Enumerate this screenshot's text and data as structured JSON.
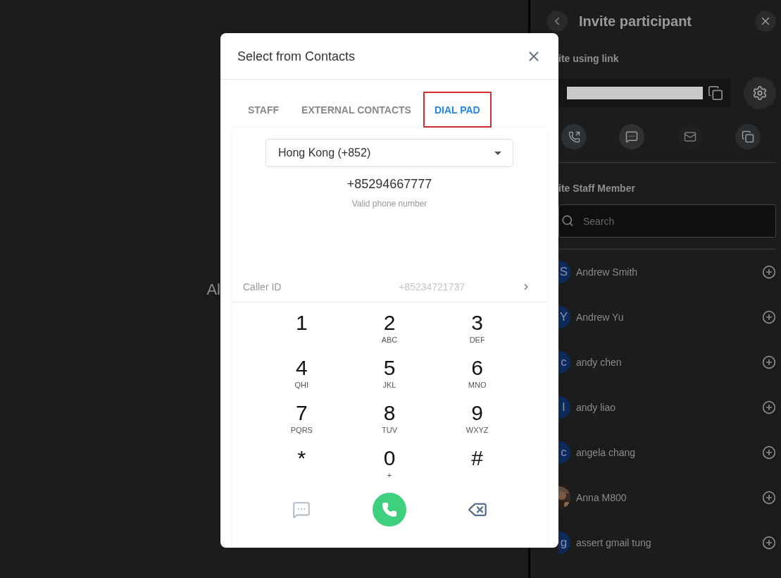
{
  "background": {
    "text": "Al"
  },
  "modal": {
    "title": "Select from Contacts",
    "tabs": [
      {
        "label": "STAFF",
        "selected": false
      },
      {
        "label": "EXTERNAL CONTACTS",
        "selected": false
      },
      {
        "label": "DIAL PAD",
        "selected": true
      }
    ],
    "country": "Hong Kong (+852)",
    "number": "+85294667777",
    "validity": "Valid phone number",
    "caller_id": {
      "label": "Caller ID",
      "value": "+85234721737"
    },
    "keys": [
      {
        "digit": "1"
      },
      {
        "digit": "2",
        "letters": "ABC"
      },
      {
        "digit": "3",
        "letters": "DEF"
      },
      {
        "digit": "4",
        "letters": "QHI"
      },
      {
        "digit": "5",
        "letters": "JKL"
      },
      {
        "digit": "6",
        "letters": "MNO"
      },
      {
        "digit": "7",
        "letters": "PQRS"
      },
      {
        "digit": "8",
        "letters": "TUV"
      },
      {
        "digit": "9",
        "letters": "WXYZ"
      },
      {
        "digit": "*"
      },
      {
        "digit": "0",
        "letters": "+"
      },
      {
        "digit": "#"
      }
    ]
  },
  "panel": {
    "title": "Invite participant",
    "link_heading": "ite using link",
    "staff_heading": "ite Staff Member",
    "search_placeholder": "Search",
    "members": [
      {
        "kind": "initials",
        "initials": "S",
        "name": "Andrew Smith"
      },
      {
        "kind": "initials",
        "initials": "Y",
        "name": "Andrew Yu"
      },
      {
        "kind": "initials",
        "initials": "c",
        "name": "andy chen"
      },
      {
        "kind": "initials",
        "initials": "l",
        "name": "andy liao"
      },
      {
        "kind": "initials",
        "initials": "c",
        "name": "angela chang"
      },
      {
        "name": "Anna M800"
      },
      {
        "kind": "initials",
        "initials": "g",
        "name": "assert gmail tung"
      }
    ]
  }
}
